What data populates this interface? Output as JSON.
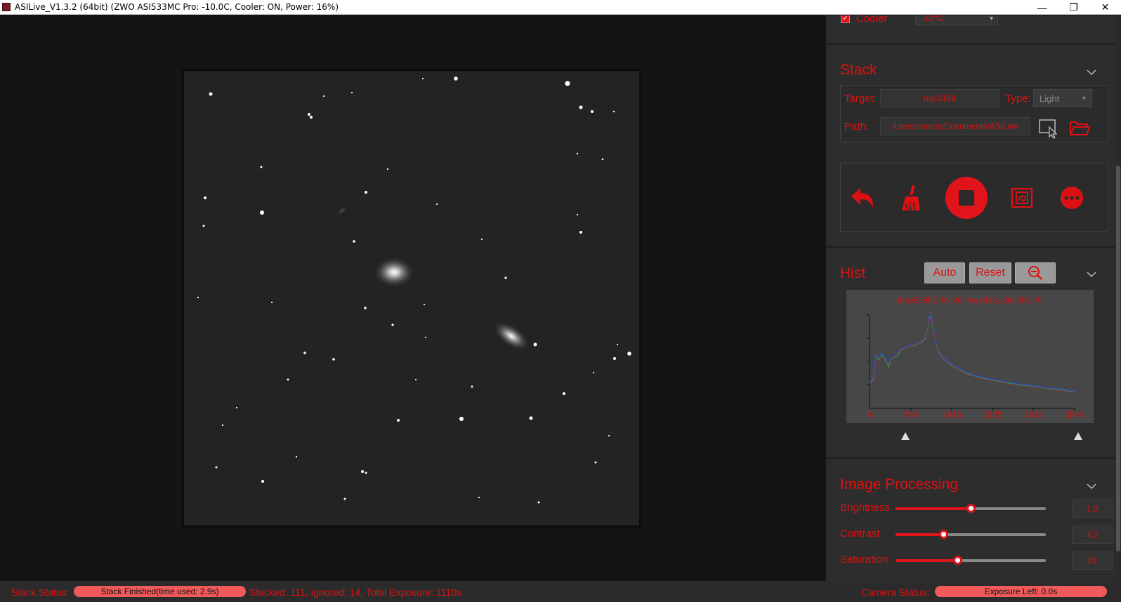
{
  "window": {
    "title": "ASILive_V1.3.2 (64bit)  (ZWO ASI533MC Pro: -10.0C, Cooler: ON, Power: 16%)",
    "minimize_glyph": "—",
    "restore_glyph": "❐",
    "close_glyph": "✕"
  },
  "cooler": {
    "label": "Cooler",
    "checked": true,
    "value": "-10°C"
  },
  "stack": {
    "title": "Stack",
    "target_label": "Target:",
    "target_value": "ngc3169",
    "type_label": "Type:",
    "type_value": "Light",
    "path_label": "Path:",
    "path_value": "/Users/marcb/Documents/ASILive",
    "controls": [
      "undo-icon",
      "clear-broom-icon",
      "stop-icon",
      "save-image-icon",
      "more-icon"
    ]
  },
  "hist": {
    "title": "Hist",
    "auto_label": "Auto",
    "reset_label": "Reset",
    "stats": "Max62953, Min:8, Avg:815, Std:356.70",
    "ticks": [
      "0",
      "708",
      "1416",
      "2125",
      "2833",
      "3542"
    ]
  },
  "image_processing": {
    "title": "Image Processing",
    "sliders": [
      {
        "label": "Brightness",
        "value": "1.0",
        "level": 0.5
      },
      {
        "label": "Contrast",
        "value": "3.2",
        "level": 0.32
      },
      {
        "label": "Saturation",
        "value": "21",
        "level": 0.41
      }
    ]
  },
  "status": {
    "stack_label": "Stack Status:",
    "stack_pill": "Stack Finished(time used: 2.9s)",
    "stack_summary": "Stacked: 111, Ignored: 14, Total Exposure: 1110s",
    "camera_label": "Camera Status:",
    "camera_pill": "Exposure Left: 0.0s"
  },
  "colors": {
    "accent": "#dd1111",
    "panel": "#2d2d2d",
    "viewer": "#141414"
  }
}
